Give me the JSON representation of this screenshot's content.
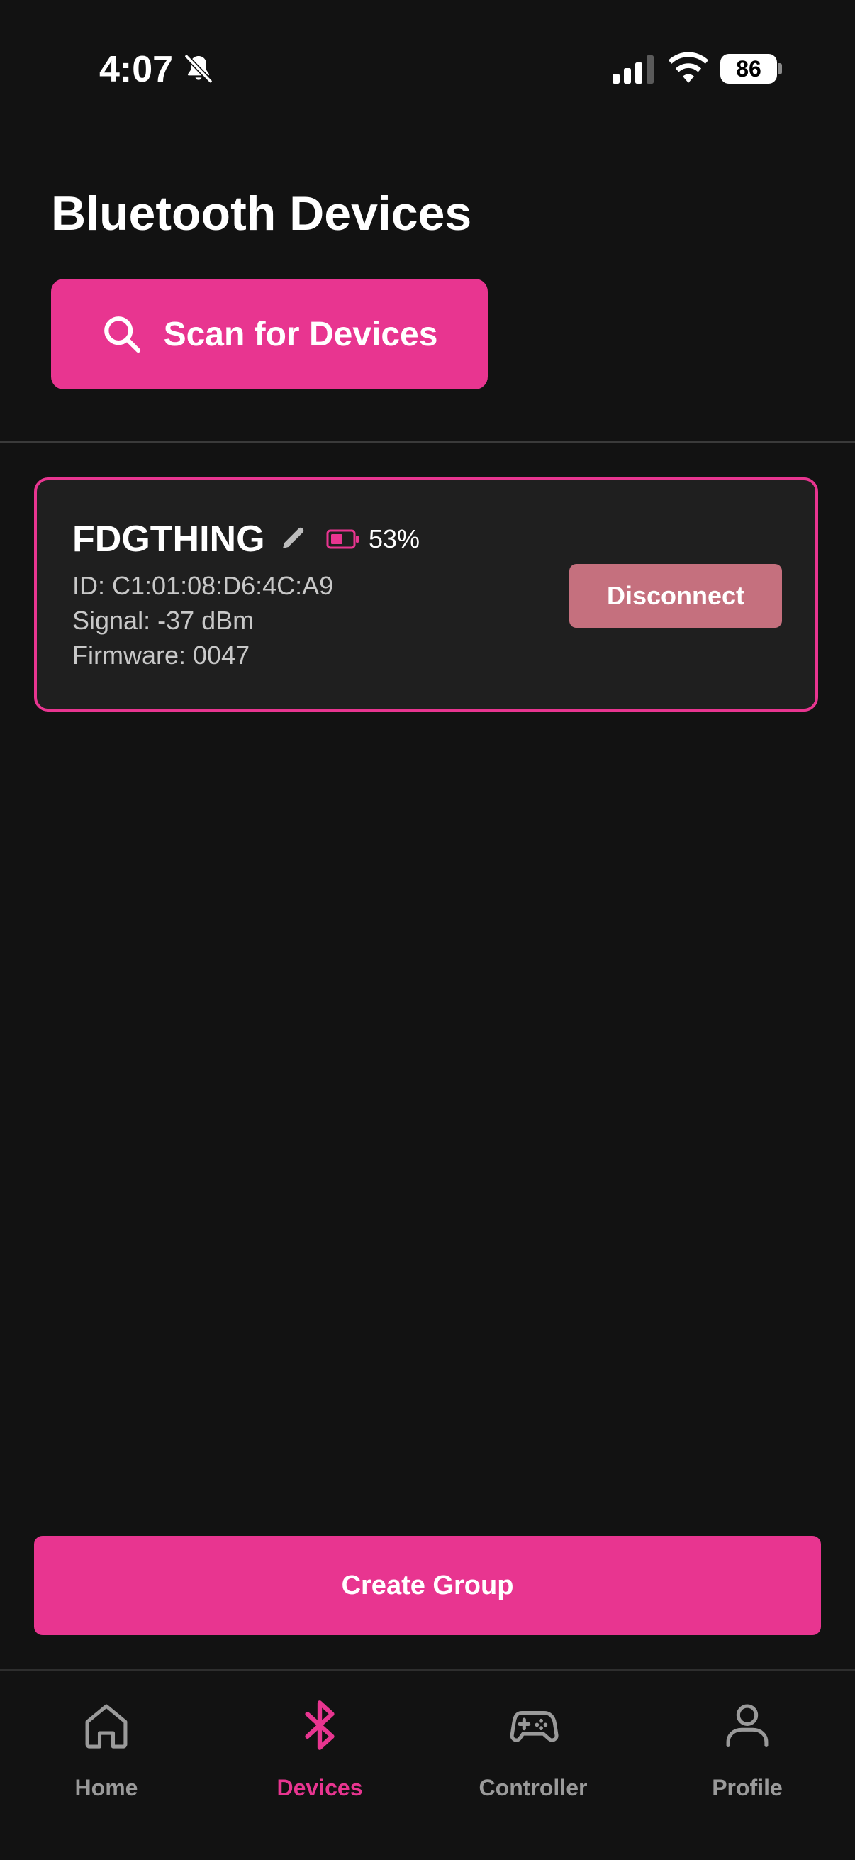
{
  "status_bar": {
    "time": "4:07",
    "battery": "86"
  },
  "header": {
    "title": "Bluetooth Devices",
    "scan_label": "Scan for Devices"
  },
  "device": {
    "name": "FDGTHING",
    "battery": "53%",
    "id": "ID: C1:01:08:D6:4C:A9",
    "signal": "Signal: -37 dBm",
    "firmware": "Firmware: 0047",
    "disconnect_label": "Disconnect"
  },
  "create_group_label": "Create Group",
  "nav": [
    {
      "label": "Home",
      "icon": "home-icon"
    },
    {
      "label": "Devices",
      "icon": "bluetooth-icon",
      "active": true
    },
    {
      "label": "Controller",
      "icon": "gamepad-icon"
    },
    {
      "label": "Profile",
      "icon": "user-icon"
    }
  ],
  "colors": {
    "accent": "#e83590",
    "background": "#121212",
    "card": "#1f1f1f",
    "disconnect": "#c5707e"
  }
}
